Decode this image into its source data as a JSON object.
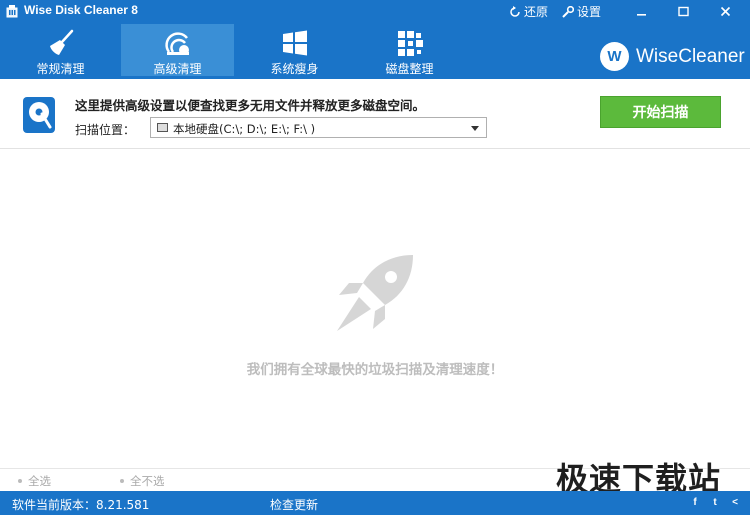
{
  "window": {
    "title": "Wise Disk Cleaner 8",
    "restore_label": "还原",
    "settings_label": "设置"
  },
  "nav": {
    "tabs": [
      {
        "label": "常规清理",
        "icon": "broom-icon"
      },
      {
        "label": "高级清理",
        "icon": "vacuum-icon",
        "active": true
      },
      {
        "label": "系统瘦身",
        "icon": "windows-icon"
      },
      {
        "label": "磁盘整理",
        "icon": "defrag-icon"
      }
    ],
    "brand": "WiseCleaner",
    "brand_logo_letter": "W"
  },
  "info": {
    "description": "这里提供高级设置以便查找更多无用文件并释放更多磁盘空间。",
    "scan_location_label": "扫描位置：",
    "scan_location_value": "本地硬盘(C:\\; D:\\; E:\\; F:\\ )",
    "start_scan_label": "开始扫描"
  },
  "main": {
    "empty_message": "我们拥有全球最快的垃圾扫描及清理速度！"
  },
  "selection": {
    "select_all": "全选",
    "select_none": "全不选"
  },
  "watermark": "极速下载站",
  "status": {
    "version": "软件当前版本：8.21.581",
    "check_update": "检查更新"
  },
  "colors": {
    "brand_blue": "#1a74c8",
    "active_tab": "#3a8fd6",
    "scan_green": "#5cba3c"
  }
}
